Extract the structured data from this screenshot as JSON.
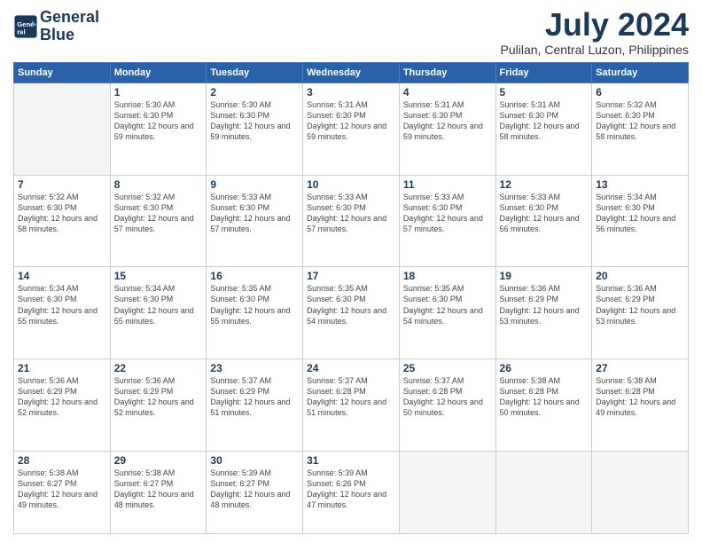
{
  "logo": {
    "line1": "General",
    "line2": "Blue"
  },
  "title": "July 2024",
  "location": "Pulilan, Central Luzon, Philippines",
  "weekdays": [
    "Sunday",
    "Monday",
    "Tuesday",
    "Wednesday",
    "Thursday",
    "Friday",
    "Saturday"
  ],
  "weeks": [
    [
      {
        "day": "",
        "info": ""
      },
      {
        "day": "1",
        "info": "Sunrise: 5:30 AM\nSunset: 6:30 PM\nDaylight: 12 hours\nand 59 minutes."
      },
      {
        "day": "2",
        "info": "Sunrise: 5:30 AM\nSunset: 6:30 PM\nDaylight: 12 hours\nand 59 minutes."
      },
      {
        "day": "3",
        "info": "Sunrise: 5:31 AM\nSunset: 6:30 PM\nDaylight: 12 hours\nand 59 minutes."
      },
      {
        "day": "4",
        "info": "Sunrise: 5:31 AM\nSunset: 6:30 PM\nDaylight: 12 hours\nand 59 minutes."
      },
      {
        "day": "5",
        "info": "Sunrise: 5:31 AM\nSunset: 6:30 PM\nDaylight: 12 hours\nand 58 minutes."
      },
      {
        "day": "6",
        "info": "Sunrise: 5:32 AM\nSunset: 6:30 PM\nDaylight: 12 hours\nand 58 minutes."
      }
    ],
    [
      {
        "day": "7",
        "info": "Sunrise: 5:32 AM\nSunset: 6:30 PM\nDaylight: 12 hours\nand 58 minutes."
      },
      {
        "day": "8",
        "info": "Sunrise: 5:32 AM\nSunset: 6:30 PM\nDaylight: 12 hours\nand 57 minutes."
      },
      {
        "day": "9",
        "info": "Sunrise: 5:33 AM\nSunset: 6:30 PM\nDaylight: 12 hours\nand 57 minutes."
      },
      {
        "day": "10",
        "info": "Sunrise: 5:33 AM\nSunset: 6:30 PM\nDaylight: 12 hours\nand 57 minutes."
      },
      {
        "day": "11",
        "info": "Sunrise: 5:33 AM\nSunset: 6:30 PM\nDaylight: 12 hours\nand 57 minutes."
      },
      {
        "day": "12",
        "info": "Sunrise: 5:33 AM\nSunset: 6:30 PM\nDaylight: 12 hours\nand 56 minutes."
      },
      {
        "day": "13",
        "info": "Sunrise: 5:34 AM\nSunset: 6:30 PM\nDaylight: 12 hours\nand 56 minutes."
      }
    ],
    [
      {
        "day": "14",
        "info": "Sunrise: 5:34 AM\nSunset: 6:30 PM\nDaylight: 12 hours\nand 55 minutes."
      },
      {
        "day": "15",
        "info": "Sunrise: 5:34 AM\nSunset: 6:30 PM\nDaylight: 12 hours\nand 55 minutes."
      },
      {
        "day": "16",
        "info": "Sunrise: 5:35 AM\nSunset: 6:30 PM\nDaylight: 12 hours\nand 55 minutes."
      },
      {
        "day": "17",
        "info": "Sunrise: 5:35 AM\nSunset: 6:30 PM\nDaylight: 12 hours\nand 54 minutes."
      },
      {
        "day": "18",
        "info": "Sunrise: 5:35 AM\nSunset: 6:30 PM\nDaylight: 12 hours\nand 54 minutes."
      },
      {
        "day": "19",
        "info": "Sunrise: 5:36 AM\nSunset: 6:29 PM\nDaylight: 12 hours\nand 53 minutes."
      },
      {
        "day": "20",
        "info": "Sunrise: 5:36 AM\nSunset: 6:29 PM\nDaylight: 12 hours\nand 53 minutes."
      }
    ],
    [
      {
        "day": "21",
        "info": "Sunrise: 5:36 AM\nSunset: 6:29 PM\nDaylight: 12 hours\nand 52 minutes."
      },
      {
        "day": "22",
        "info": "Sunrise: 5:36 AM\nSunset: 6:29 PM\nDaylight: 12 hours\nand 52 minutes."
      },
      {
        "day": "23",
        "info": "Sunrise: 5:37 AM\nSunset: 6:29 PM\nDaylight: 12 hours\nand 51 minutes."
      },
      {
        "day": "24",
        "info": "Sunrise: 5:37 AM\nSunset: 6:28 PM\nDaylight: 12 hours\nand 51 minutes."
      },
      {
        "day": "25",
        "info": "Sunrise: 5:37 AM\nSunset: 6:28 PM\nDaylight: 12 hours\nand 50 minutes."
      },
      {
        "day": "26",
        "info": "Sunrise: 5:38 AM\nSunset: 6:28 PM\nDaylight: 12 hours\nand 50 minutes."
      },
      {
        "day": "27",
        "info": "Sunrise: 5:38 AM\nSunset: 6:28 PM\nDaylight: 12 hours\nand 49 minutes."
      }
    ],
    [
      {
        "day": "28",
        "info": "Sunrise: 5:38 AM\nSunset: 6:27 PM\nDaylight: 12 hours\nand 49 minutes."
      },
      {
        "day": "29",
        "info": "Sunrise: 5:38 AM\nSunset: 6:27 PM\nDaylight: 12 hours\nand 48 minutes."
      },
      {
        "day": "30",
        "info": "Sunrise: 5:39 AM\nSunset: 6:27 PM\nDaylight: 12 hours\nand 48 minutes."
      },
      {
        "day": "31",
        "info": "Sunrise: 5:39 AM\nSunset: 6:26 PM\nDaylight: 12 hours\nand 47 minutes."
      },
      {
        "day": "",
        "info": ""
      },
      {
        "day": "",
        "info": ""
      },
      {
        "day": "",
        "info": ""
      }
    ]
  ]
}
